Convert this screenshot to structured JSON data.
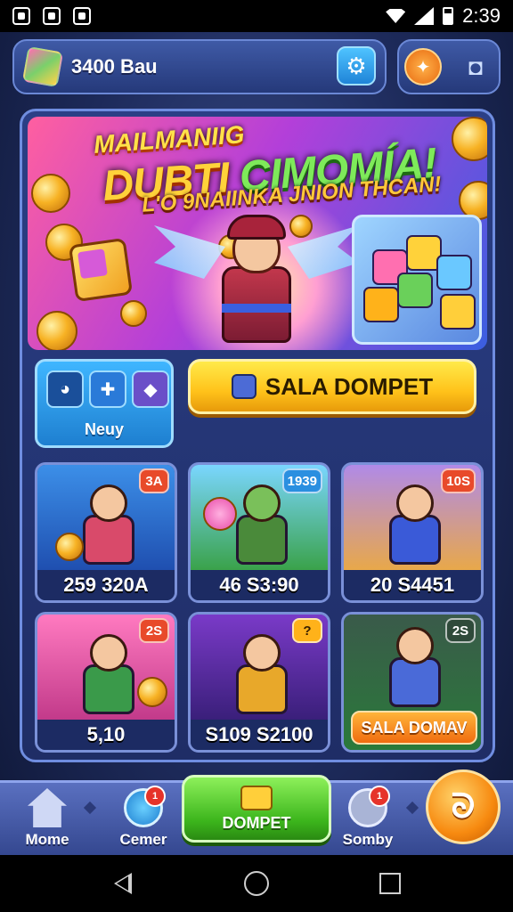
{
  "status_bar": {
    "time": "2:39"
  },
  "topbar": {
    "coins": "3400 Bau"
  },
  "banner": {
    "title_line1": "MAILMANIIG",
    "title_word_yellow": "DUBTI",
    "title_word_green": "CIMOMÍA!",
    "subtitle": "L'O 9NAIINKA JNION THCAN!"
  },
  "menu_card": {
    "label": "Neuy"
  },
  "cta": {
    "label": "SALA DOMPET"
  },
  "tiles": [
    {
      "price": "259 320A",
      "badge": "3A",
      "badge_color": "#e84a2a"
    },
    {
      "price": "46 S3:90",
      "badge": "1939",
      "badge_color": "#2a8fe0"
    },
    {
      "price": "20 S4451",
      "badge": "10S",
      "badge_color": "#e84a2a"
    },
    {
      "price": "5,10",
      "badge": "2S",
      "badge_color": "#e84a2a"
    },
    {
      "price": "S109 S2100",
      "badge": "?",
      "badge_color": "#ffb21a"
    },
    {
      "sale_label": "SALA DOMAV",
      "badge": "2S",
      "badge_color": "#2f4a3a"
    }
  ],
  "bottom_nav": {
    "home_label": "Mome",
    "game_label": "Cemer",
    "game_badge": "1",
    "dompet_label": "DOMPET",
    "shop_label": "Somby",
    "shop_badge": "1",
    "fab_symbol": "ᘐ"
  }
}
